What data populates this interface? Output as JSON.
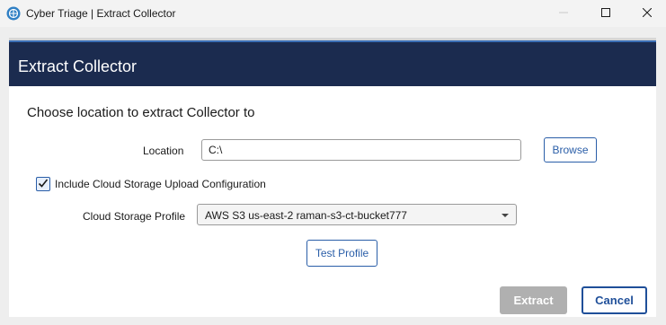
{
  "window": {
    "title": "Cyber Triage | Extract Collector",
    "icons": {
      "app": "cyber-triage-logo-icon",
      "minimize": "minimize-icon",
      "maximize": "maximize-icon",
      "close": "close-icon"
    }
  },
  "dialog": {
    "header_title": "Extract Collector",
    "instruction": "Choose location to extract Collector to",
    "location": {
      "label": "Location",
      "value": "C:\\",
      "browse_label": "Browse"
    },
    "cloud_checkbox": {
      "label": "Include Cloud Storage Upload Configuration",
      "checked": true
    },
    "profile": {
      "label": "Cloud Storage Profile",
      "selected": "AWS S3 us-east-2 raman-s3-ct-bucket777"
    },
    "test_profile_label": "Test Profile",
    "extract_label": "Extract",
    "cancel_label": "Cancel"
  },
  "colors": {
    "header_bg": "#1b2b4f",
    "accent": "#2a5ea8",
    "disabled_button": "#b0b0b0"
  }
}
